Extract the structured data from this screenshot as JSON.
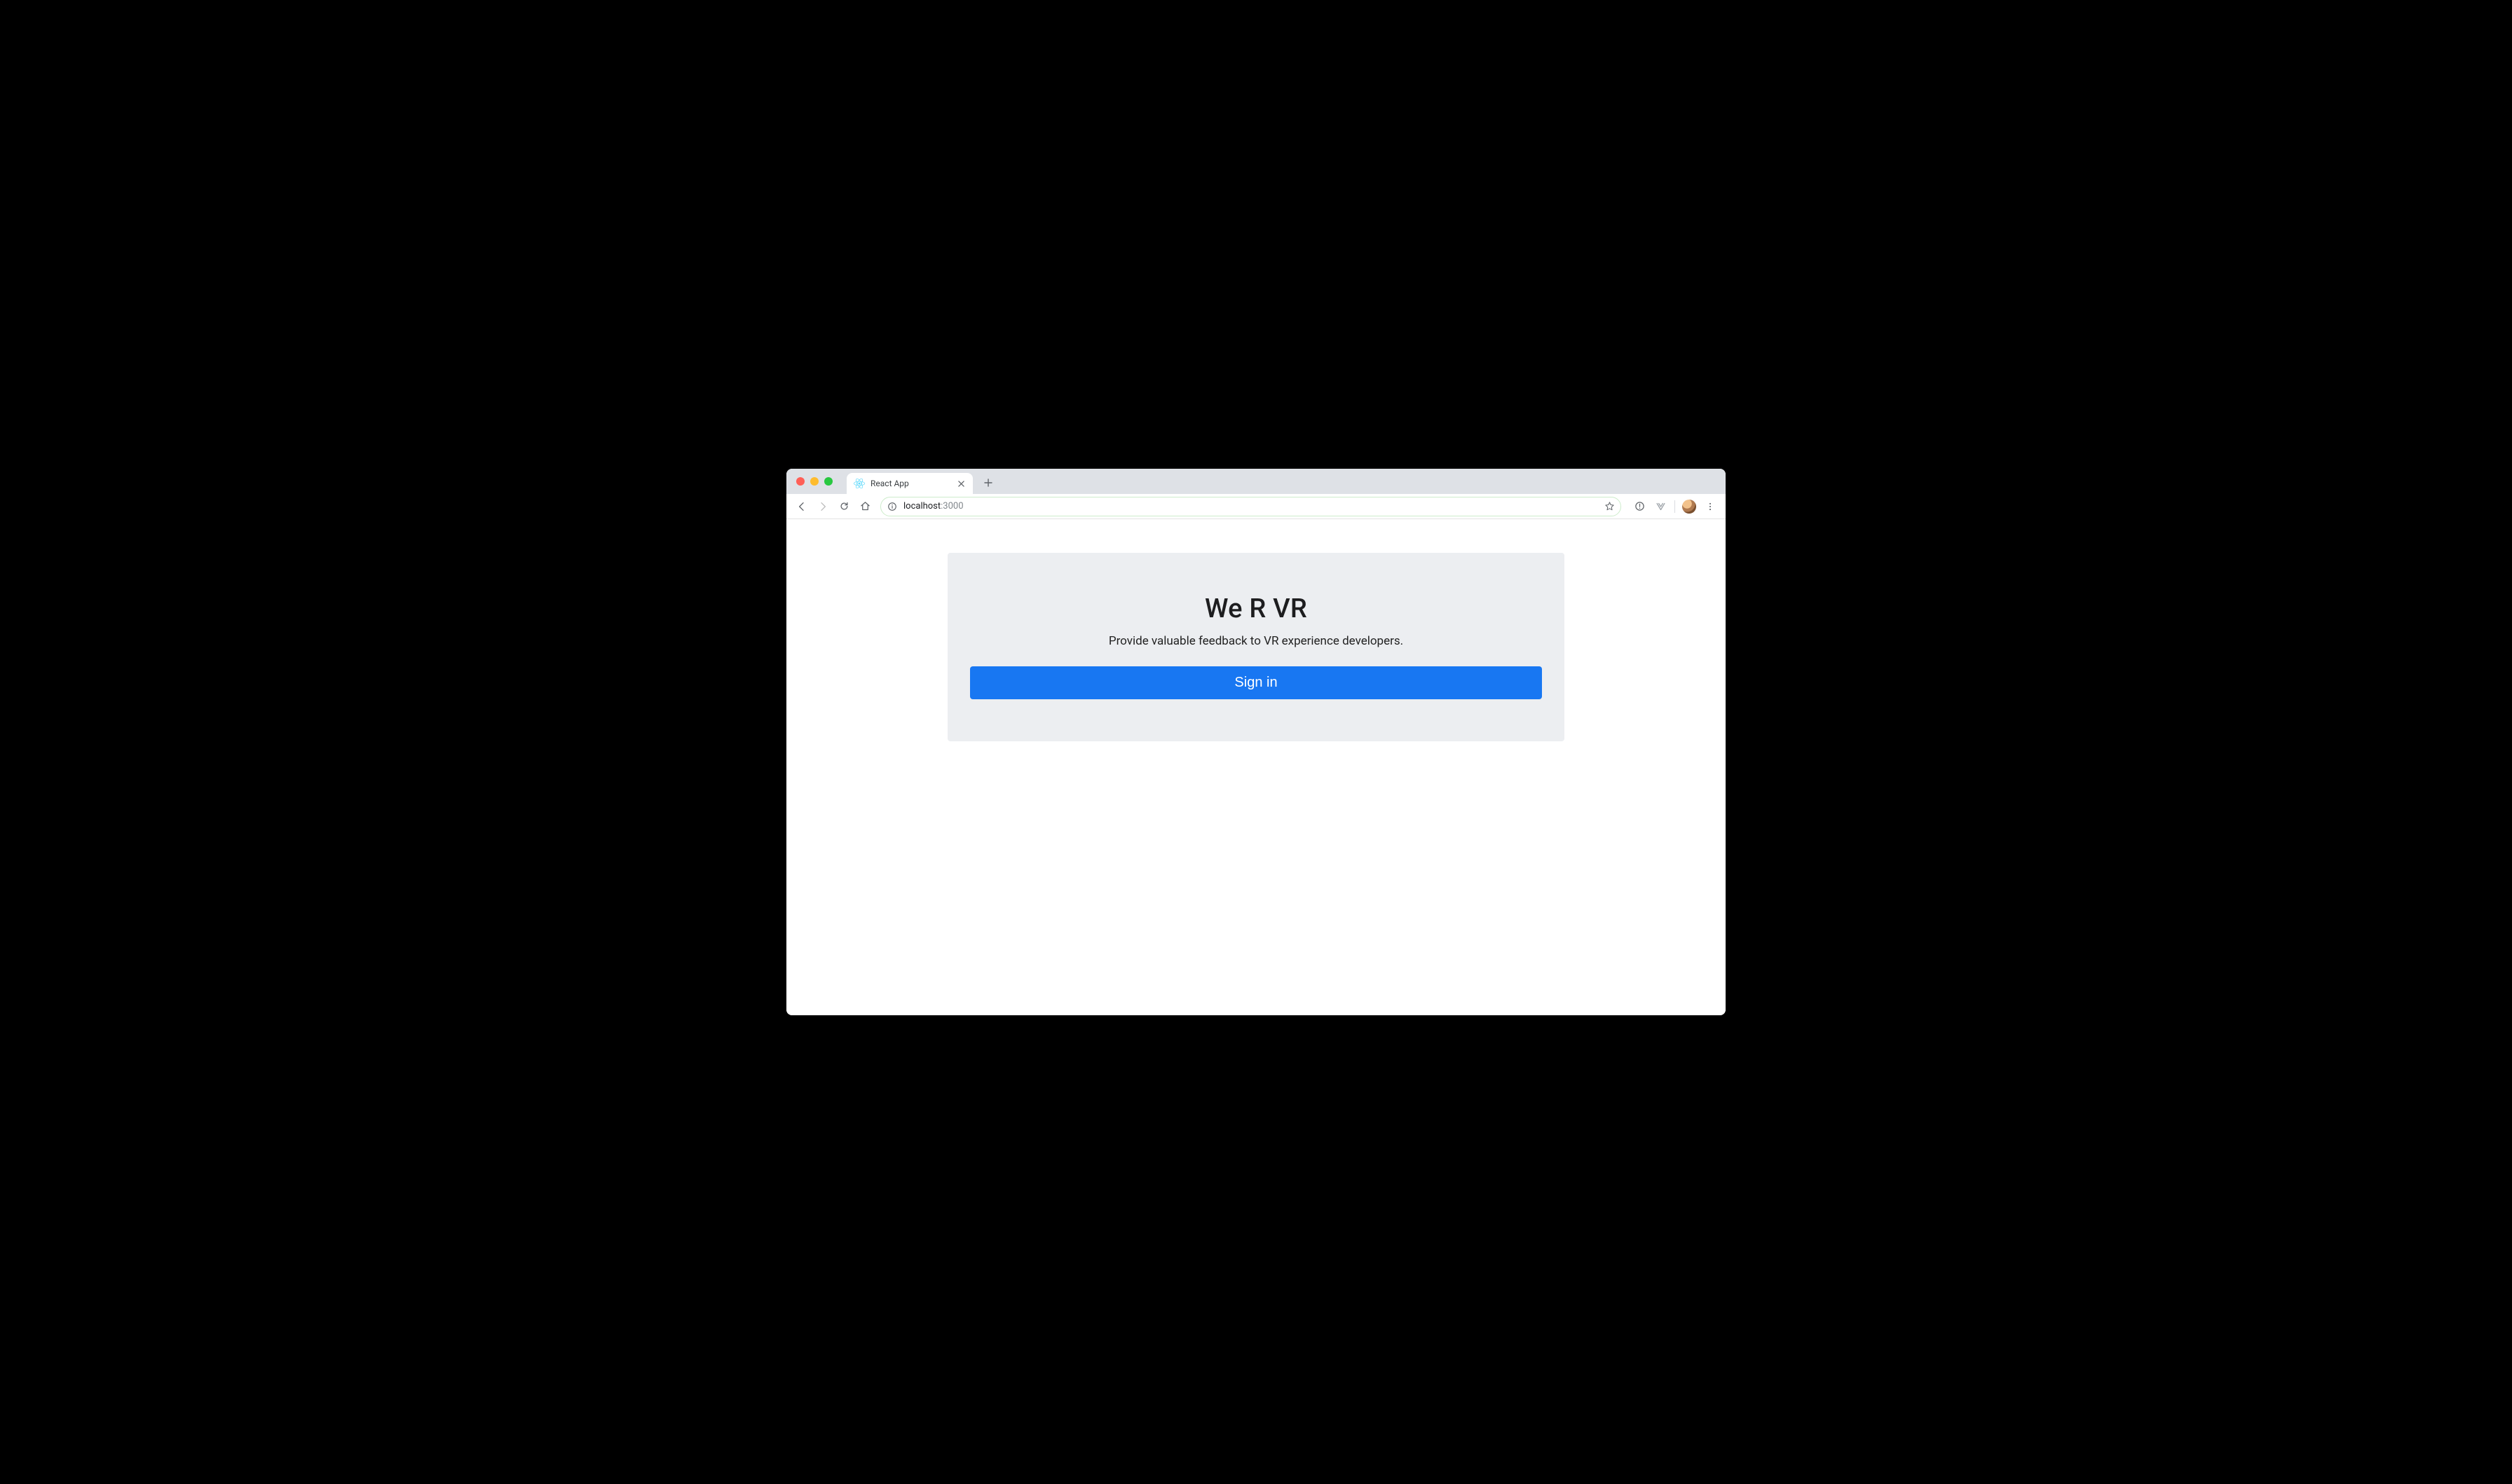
{
  "browser": {
    "tab_title": "React App",
    "url_host": "localhost",
    "url_port": ":3000"
  },
  "page": {
    "heading": "We R VR",
    "subheading": "Provide valuable feedback to VR experience developers.",
    "signin_label": "Sign in"
  }
}
